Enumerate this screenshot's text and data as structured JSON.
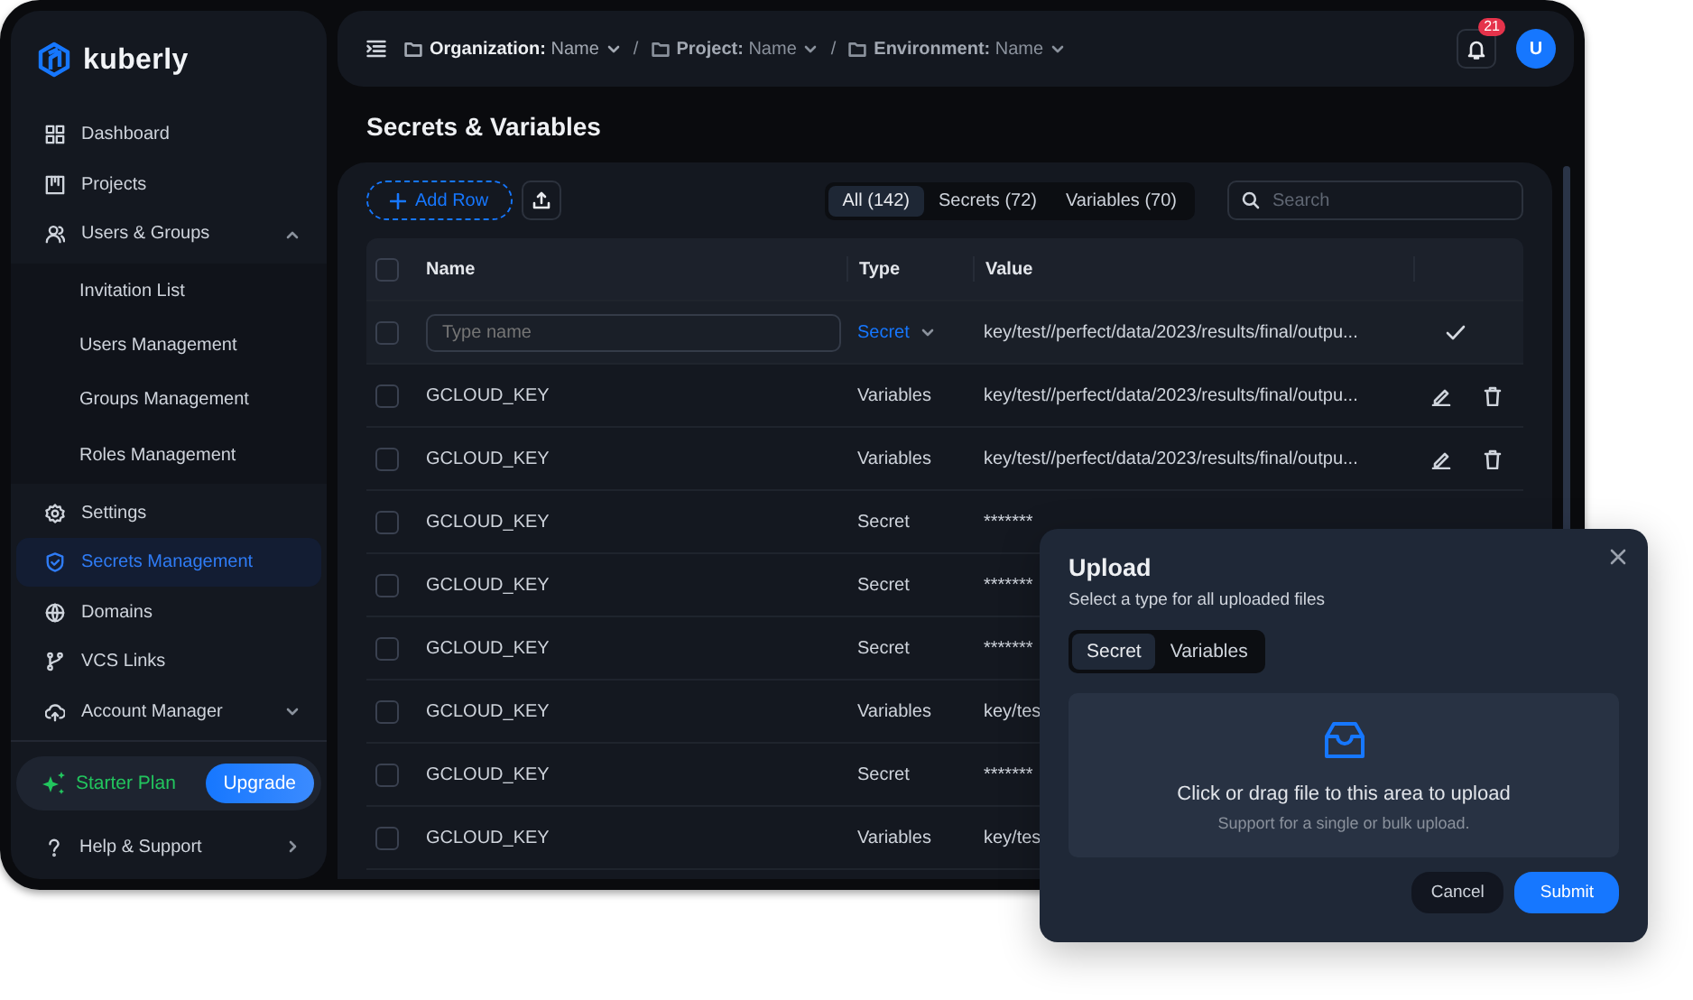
{
  "sidebar": {
    "logo": "kuberly",
    "items": [
      {
        "label": "Dashboard",
        "selected": false
      },
      {
        "label": "Projects",
        "selected": false
      },
      {
        "label": "Users & Groups",
        "selected": false,
        "expanded": true,
        "children": [
          {
            "label": "Invitation List",
            "selected": false
          },
          {
            "label": "Users Management",
            "selected": false
          },
          {
            "label": "Groups Management",
            "selected": false
          },
          {
            "label": "Roles Management",
            "selected": false
          }
        ]
      },
      {
        "label": "Settings",
        "selected": false
      },
      {
        "label": "Secrets Management",
        "selected": true
      },
      {
        "label": "Domains",
        "selected": false
      },
      {
        "label": "VCS Links",
        "selected": false
      },
      {
        "label": "Account Manager",
        "selected": false,
        "expanded": false
      }
    ],
    "plan": {
      "label": "Starter Plan",
      "button": "Upgrade"
    },
    "help": "Help & Support"
  },
  "topbar": {
    "breadcrumbs": [
      {
        "label": "**Organization:** Name",
        "active": true
      },
      {
        "label": "**Project:** Name",
        "active": false
      },
      {
        "label": "**Environment:** Name",
        "active": false
      }
    ],
    "separators": [
      "/",
      "/"
    ],
    "notifications": "21",
    "avatar": "U"
  },
  "page_title": "Secrets & Variables",
  "toolbar": {
    "add_button": "Add Row",
    "filters": [
      {
        "label": "All (142)",
        "selected": true
      },
      {
        "label": "Secrets (72)",
        "selected": false
      },
      {
        "label": "Variables (70)",
        "selected": false
      }
    ],
    "search": {
      "placeholder": "Search"
    }
  },
  "table": {
    "columns": [
      "Name",
      "Type",
      "Value"
    ],
    "select_all": false,
    "new_row": {
      "checked": false,
      "placeholder": "Type name",
      "type": "Secret",
      "value": "key/test//perfect/data/2023/results/final/outpu..."
    },
    "rows": [
      {
        "checked": false,
        "name": "GCLOUD_KEY",
        "type": "Variables",
        "value": "key/test//perfect/data/2023/results/final/outpu...",
        "actions": true
      },
      {
        "checked": false,
        "name": "GCLOUD_KEY",
        "type": "Variables",
        "value": "key/test//perfect/data/2023/results/final/outpu...",
        "actions": true
      },
      {
        "checked": false,
        "name": "GCLOUD_KEY",
        "type": "Secret",
        "value": "*******"
      },
      {
        "checked": false,
        "name": "GCLOUD_KEY",
        "type": "Secret",
        "value": "*******"
      },
      {
        "checked": false,
        "name": "GCLOUD_KEY",
        "type": "Secret",
        "value": "*******"
      },
      {
        "checked": false,
        "name": "GCLOUD_KEY",
        "type": "Variables",
        "value": "key/tes"
      },
      {
        "checked": false,
        "name": "GCLOUD_KEY",
        "type": "Secret",
        "value": "*******"
      },
      {
        "checked": false,
        "name": "GCLOUD_KEY",
        "type": "Variables",
        "value": "key/tes"
      }
    ]
  },
  "modal": {
    "title": "Upload",
    "subtitle": "Select a type for all uploaded files",
    "type_options": [
      {
        "label": "Secret",
        "selected": true
      },
      {
        "label": "Variables",
        "selected": false
      }
    ],
    "dropzone": {
      "text": "Click or drag file to this area to upload",
      "hint": "Support for a single or bulk upload."
    },
    "buttons": [
      {
        "label": "Cancel",
        "kind": "secondary"
      },
      {
        "label": "Submit",
        "kind": "primary"
      }
    ]
  }
}
